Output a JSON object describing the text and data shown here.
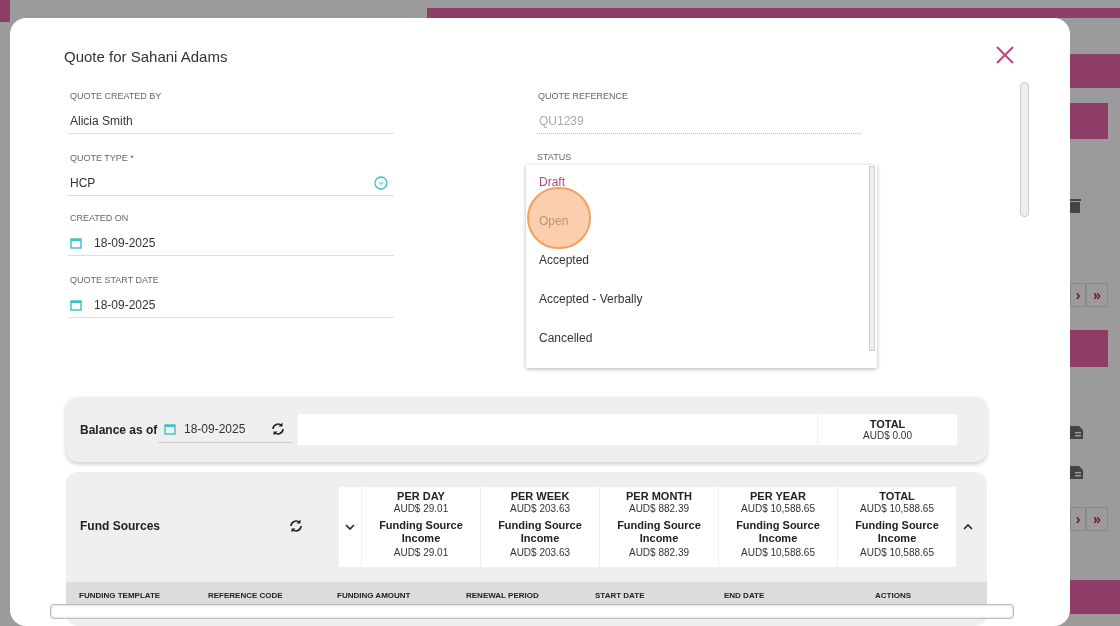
{
  "background": {
    "pagers": [
      {
        "next": "›",
        "last": "»"
      },
      {
        "next": "›",
        "last": "»"
      }
    ]
  },
  "dialog": {
    "title": "Quote for Sahani Adams",
    "left_fields": [
      {
        "kind": "text",
        "label": "QUOTE CREATED BY",
        "value": "Alicia Smith"
      },
      {
        "kind": "select",
        "label": "QUOTE TYPE *",
        "value": "HCP"
      },
      {
        "kind": "date",
        "label": "CREATED ON",
        "value": "18-09-2025"
      },
      {
        "kind": "date",
        "label": "QUOTE START DATE",
        "value": "18-09-2025"
      }
    ],
    "reference": {
      "label": "QUOTE REFERENCE",
      "value": "QU1239",
      "disabled": true
    },
    "status": {
      "label": "STATUS",
      "options": [
        {
          "label": "Draft",
          "selected": true
        },
        {
          "label": "Open",
          "selected": false
        },
        {
          "label": "Accepted",
          "selected": false
        },
        {
          "label": "Accepted - Verbally",
          "selected": false
        },
        {
          "label": "Cancelled",
          "selected": false
        }
      ]
    },
    "balance": {
      "label": "Balance as of",
      "date": "18-09-2025",
      "total_label": "TOTAL",
      "total_value": "AUD$ 0.00"
    },
    "fund_sources": {
      "title": "Fund Sources",
      "periods": [
        {
          "period": "PER DAY",
          "amount": "AUD$ 29.01",
          "source": "Funding Source Income",
          "source_amount": "AUD$ 29.01"
        },
        {
          "period": "PER WEEK",
          "amount": "AUD$ 203.63",
          "source": "Funding Source Income",
          "source_amount": "AUD$ 203.63"
        },
        {
          "period": "PER MONTH",
          "amount": "AUD$ 882.39",
          "source": "Funding Source Income",
          "source_amount": "AUD$ 882.39"
        },
        {
          "period": "PER YEAR",
          "amount": "AUD$ 10,588.65",
          "source": "Funding Source Income",
          "source_amount": "AUD$ 10,588.65"
        },
        {
          "period": "TOTAL",
          "amount": "AUD$ 10,588.65",
          "source": "Funding Source Income",
          "source_amount": "AUD$ 10,588.65"
        }
      ],
      "columns": [
        "FUNDING TEMPLATE",
        "REFERENCE CODE",
        "FUNDING AMOUNT",
        "RENEWAL PERIOD",
        "START DATE",
        "END DATE",
        "ACTIONS"
      ]
    }
  }
}
